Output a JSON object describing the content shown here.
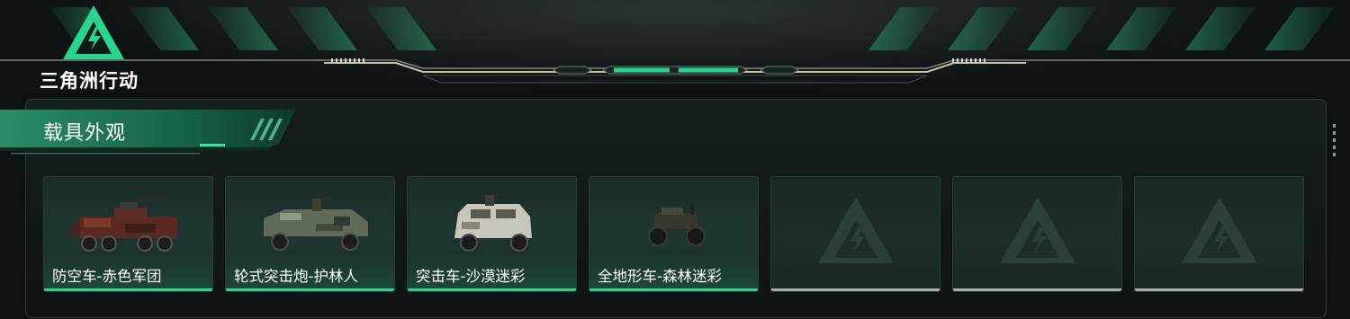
{
  "header": {
    "brand_name": "三角洲行动",
    "logo_icon": "delta-triangle-logo",
    "accent_color": "#2ad38e"
  },
  "section": {
    "title": "载具外观"
  },
  "skins": [
    {
      "label": "防空车-赤色军团",
      "icon": "anti-air-vehicle",
      "state": "filled"
    },
    {
      "label": "轮式突击炮-护林人",
      "icon": "wheeled-assault-gun",
      "state": "filled"
    },
    {
      "label": "突击车-沙漠迷彩",
      "icon": "assault-car",
      "state": "filled"
    },
    {
      "label": "全地形车-森林迷彩",
      "icon": "atv",
      "state": "filled"
    },
    {
      "label": "",
      "icon": "empty-slot-logo",
      "state": "empty"
    },
    {
      "label": "",
      "icon": "empty-slot-logo",
      "state": "empty"
    },
    {
      "label": "",
      "icon": "empty-slot-logo",
      "state": "empty"
    }
  ]
}
